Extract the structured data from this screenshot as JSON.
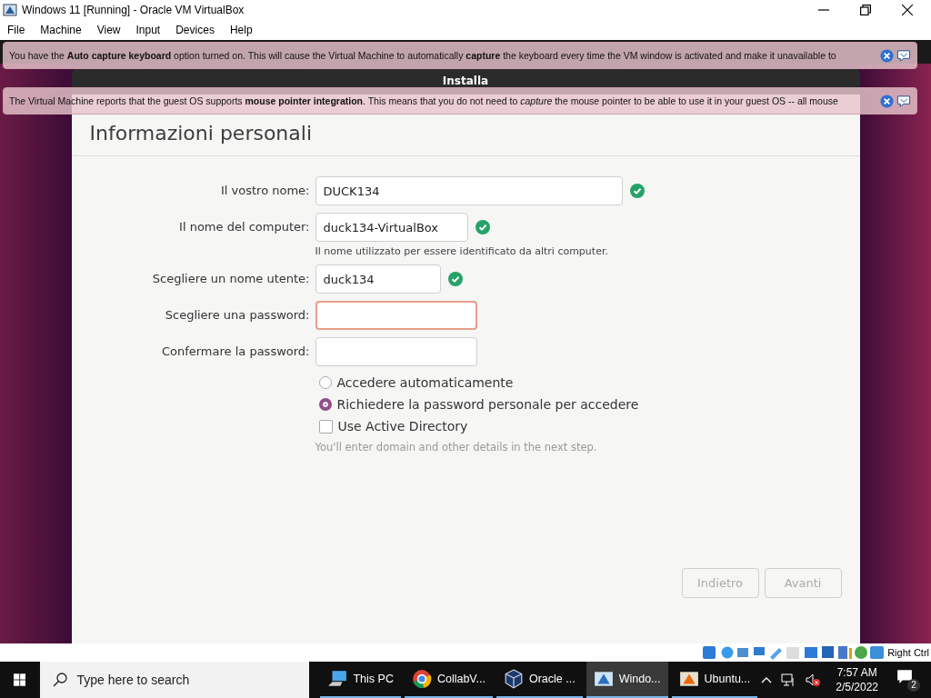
{
  "window": {
    "title": "Windows 11 [Running] - Oracle VM VirtualBox"
  },
  "menu": [
    "File",
    "Machine",
    "View",
    "Input",
    "Devices",
    "Help"
  ],
  "notices": [
    {
      "text": "You have the **Auto capture keyboard** option turned on. This will cause the Virtual Machine to automatically **capture** the keyboard every time the VM window is activated and make it unavailable to"
    },
    {
      "text": "The Virtual Machine reports that the guest OS supports **mouse pointer integration**. This means that you do not need to *capture* the mouse pointer to be able to use it in your guest OS -- all mouse"
    }
  ],
  "guest": {
    "dialog_title": "Installa",
    "heading": "Informazioni personali",
    "fields": [
      {
        "label": "Il vostro nome:",
        "value": "DUCK134",
        "valid": true,
        "error": false
      },
      {
        "label": "Il nome del computer:",
        "value": "duck134-VirtualBox",
        "valid": true,
        "error": false,
        "hint": "Il nome utilizzato per essere identificato da altri computer."
      },
      {
        "label": "Scegliere un nome utente:",
        "value": "duck134",
        "valid": true,
        "error": false
      },
      {
        "label": "Scegliere una password:",
        "valid": false,
        "error": true
      },
      {
        "label": "Confermare la password:",
        "valid": false,
        "error": false
      }
    ],
    "login_options": [
      {
        "label": "Accedere automaticamente",
        "selected": false
      },
      {
        "label": "Richiedere la password personale per accedere",
        "selected": true
      }
    ],
    "active_directory": {
      "label": "Use Active Directory",
      "checked": false
    },
    "ad_hint": "You'll enter domain and other details in the next step.",
    "buttons": [
      {
        "label": "Indietro",
        "disabled": true
      },
      {
        "label": "Avanti",
        "disabled": true
      }
    ]
  },
  "status_bar": {
    "host_key": "Right Ctrl"
  },
  "taskbar": {
    "search_placeholder": "Type here to search",
    "apps": [
      {
        "label": "This PC",
        "kind": "pc",
        "selected": false
      },
      {
        "label": "CollabV...",
        "kind": "chrome",
        "selected": false
      },
      {
        "label": "Oracle ...",
        "kind": "cube",
        "selected": false
      },
      {
        "label": "Windo...",
        "kind": "vm",
        "selected": true
      },
      {
        "label": "Ubuntu...",
        "kind": "vm2",
        "selected": false
      }
    ],
    "time": "7:57 AM",
    "date": "2/5/2022",
    "notifications": "2"
  }
}
